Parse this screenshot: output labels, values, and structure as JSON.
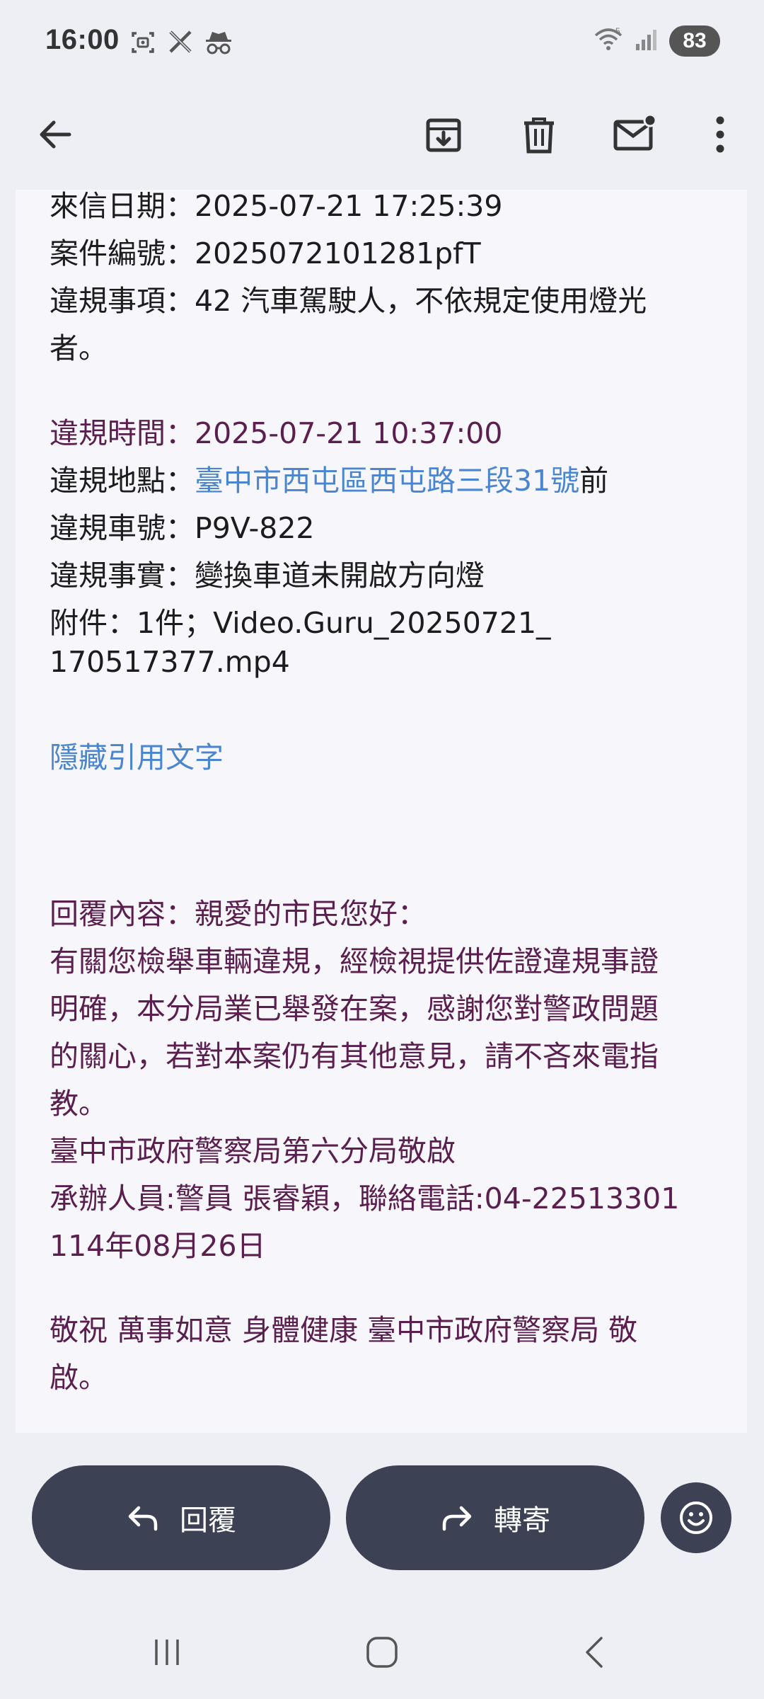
{
  "status_bar": {
    "time": "16:00",
    "left_icons": [
      "screenshot-icon",
      "x-app-icon",
      "incognito-icon"
    ],
    "right_icons": [
      "wifi-icon",
      "signal-icon"
    ],
    "battery": "83"
  },
  "toolbar": {
    "back_icon": "arrow-left-icon",
    "actions": [
      "archive-icon",
      "delete-icon",
      "mark-unread-icon",
      "more-vert-icon"
    ]
  },
  "email": {
    "date_line": "來信日期：2025-07-21 17:25:39",
    "case_line": "案件編號：2025072101281pfT",
    "violation_item_line1": "違規事項：42 汽車駕駛人，不依規定使用燈光",
    "violation_item_line2": "者。",
    "violation_time": "違規時間：2025-07-21 10:37:00",
    "violation_place_label": "違規地點：",
    "violation_place_link": "臺中市西屯區西屯路三段31號",
    "violation_place_suffix": "前",
    "violation_plate": "違規車號：P9V-822",
    "violation_fact": "違規事實：變換車道未開啟方向燈",
    "attachment_line1": "附件：1件；Video.Guru_20250721_",
    "attachment_line2": "170517377.mp4",
    "hide_quote_link": "隱藏引用文字",
    "reply_title": "回覆內容：親愛的市民您好：",
    "reply_body_1": "有關您檢舉車輛違規，經檢視提供佐證違規事證",
    "reply_body_2": "明確，本分局業已舉發在案，感謝您對警政問題",
    "reply_body_3": "的關心，若對本案仍有其他意見，請不吝來電指",
    "reply_body_4": "教。",
    "signature_org": "臺中市政府警察局第六分局敬啟",
    "signature_officer": "承辦人員:警員 張睿穎，聯絡電話:04-22513301",
    "signature_date": "114年08月26日",
    "closing_line1": "敬祝 萬事如意 身體健康 臺中市政府警察局 敬",
    "closing_line2": "啟。"
  },
  "actions": {
    "reply_label": "回覆",
    "forward_label": "轉寄",
    "emoji_icon": "emoji-icon"
  },
  "nav_bar": {
    "items": [
      "recent-apps-icon",
      "home-icon",
      "back-nav-icon"
    ]
  },
  "colors": {
    "background": "#eeeef5",
    "card": "#f6f6fb",
    "purple_text": "#5b1f4f",
    "link_blue": "#4a86d0",
    "button_dark": "#3c4254"
  }
}
